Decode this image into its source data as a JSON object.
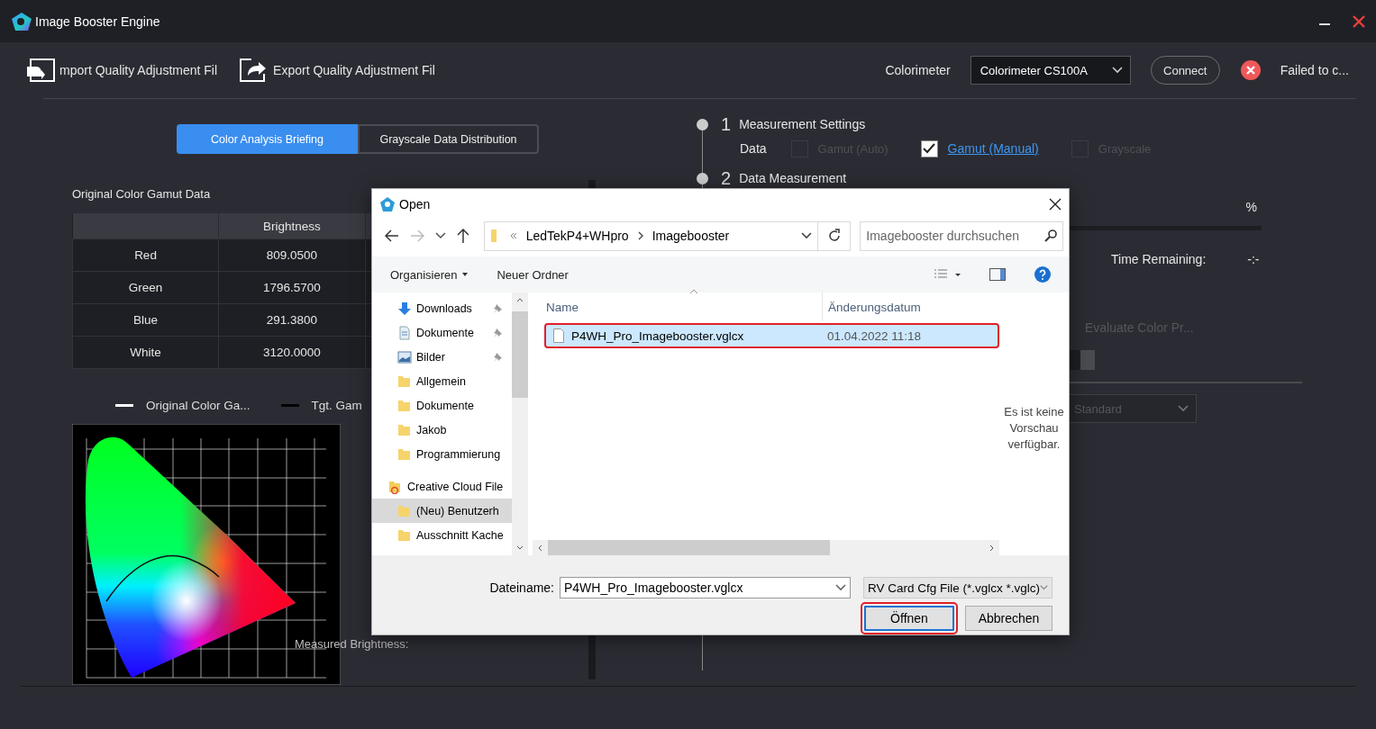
{
  "window": {
    "title": "Image Booster Engine"
  },
  "toolbar": {
    "import_label": "mport Quality Adjustment Fil",
    "export_label": "Export Quality Adjustment Fil",
    "colorimeter_label": "Colorimeter",
    "colorimeter_value": "Colorimeter CS100A",
    "connect": "Connect",
    "status": "Failed to c..."
  },
  "tabs": [
    {
      "label": "Color Analysis Briefing",
      "selected": true
    },
    {
      "label": "Grayscale Data Distribution",
      "selected": false
    }
  ],
  "gamut_table": {
    "title": "Original Color Gamut Data",
    "columns": [
      "Brightness"
    ],
    "rows": [
      {
        "name": "Red",
        "brightness": "809.0500"
      },
      {
        "name": "Green",
        "brightness": "1796.5700"
      },
      {
        "name": "Blue",
        "brightness": "291.3800"
      },
      {
        "name": "White",
        "brightness": "3120.0000"
      }
    ]
  },
  "legend": [
    "Original Color Ga...",
    "Tgt. Gam"
  ],
  "measured_label": "Measured Brightness:",
  "steps": [
    {
      "number": "1",
      "title": "Measurement Settings"
    },
    {
      "number": "2",
      "title": "Data Measurement"
    }
  ],
  "data_options": {
    "label": "Data",
    "options": [
      {
        "label": "Gamut (Auto)",
        "checked": false,
        "disabled": true,
        "kind": "text"
      },
      {
        "label": "Gamut (Manual)",
        "checked": true,
        "disabled": false,
        "kind": "link"
      },
      {
        "label": "Grayscale",
        "checked": false,
        "disabled": true,
        "kind": "text"
      }
    ]
  },
  "measurement": {
    "percent": "%",
    "time_label": "Time Remaining:",
    "time_value": "-:-",
    "evaluate": "Evaluate Color Pr...",
    "mode": "Standard"
  },
  "dialog": {
    "title": "Open",
    "breadcrumb": [
      "LedTekP4+WHpro",
      "Imagebooster"
    ],
    "search_placeholder": "Imagebooster durchsuchen",
    "commands": [
      "Organisieren",
      "Neuer Ordner"
    ],
    "nav": [
      {
        "label": "Downloads",
        "kind": "download",
        "pinned": true,
        "selected": false
      },
      {
        "label": "Dokumente",
        "kind": "document",
        "pinned": true,
        "selected": false
      },
      {
        "label": "Bilder",
        "kind": "picture",
        "pinned": true,
        "selected": false
      },
      {
        "label": "Allgemein",
        "kind": "folder",
        "pinned": false,
        "selected": false
      },
      {
        "label": "Dokumente",
        "kind": "folder",
        "pinned": false,
        "selected": false
      },
      {
        "label": "Jakob",
        "kind": "folder",
        "pinned": false,
        "selected": false
      },
      {
        "label": "Programmierung",
        "kind": "folder",
        "pinned": false,
        "selected": false
      },
      {
        "label": "Creative Cloud File",
        "kind": "cloud",
        "pinned": false,
        "selected": false
      },
      {
        "label": "(Neu) Benutzerh",
        "kind": "folder",
        "pinned": false,
        "selected": true
      },
      {
        "label": "Ausschnitt Kache",
        "kind": "folder",
        "pinned": false,
        "selected": false
      }
    ],
    "columns": [
      "Name",
      "Änderungsdatum"
    ],
    "files": [
      {
        "name": "P4WH_Pro_Imagebooster.vglcx",
        "date": "01.04.2022 11:18",
        "selected": true,
        "annotated": true
      }
    ],
    "preview": "Es ist keine Vorschau verfügbar.",
    "filename_label": "Dateiname:",
    "filename": "P4WH_Pro_Imagebooster.vglcx",
    "filetype": "RV Card Cfg File (*.vglcx *.vglc)",
    "buttons": [
      {
        "label": "Öffnen",
        "kind": "primary",
        "annotated": true
      },
      {
        "label": "Abbrechen",
        "kind": "secondary",
        "annotated": false
      }
    ]
  }
}
